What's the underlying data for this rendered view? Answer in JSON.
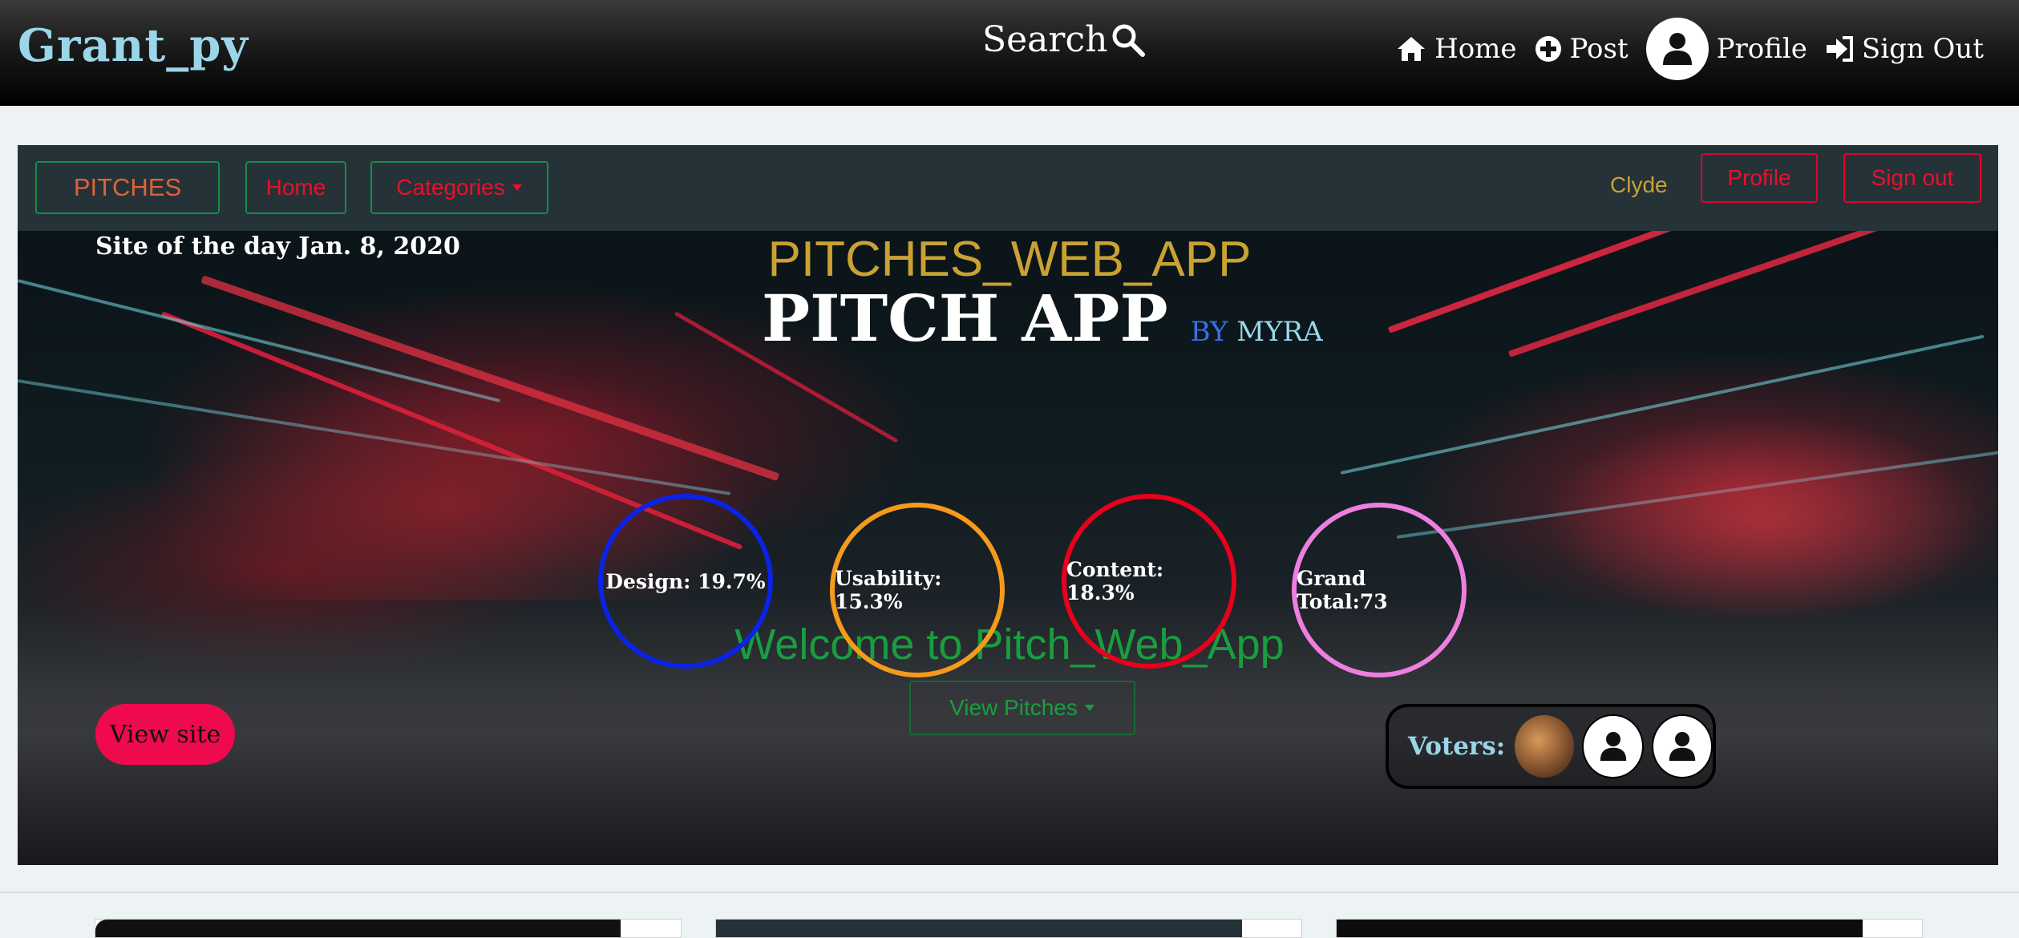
{
  "topbar": {
    "brand": "Grant_py",
    "search_label": "Search",
    "nav": {
      "home": "Home",
      "post": "Post",
      "profile": "Profile",
      "sign_out": "Sign Out"
    }
  },
  "inner_nav": {
    "brand": "PITCHES",
    "home": "Home",
    "categories": "Categories",
    "username": "Clyde",
    "profile": "Profile",
    "sign_out": "Sign out"
  },
  "hero": {
    "site_of_day": "Site of the day Jan. 8, 2020",
    "site_title": "PITCHES_WEB_APP",
    "app_name": "PITCH APP",
    "by": "BY",
    "author": "MYRA",
    "welcome": "Welcome to Pitch_Web_App",
    "view_pitches": "View Pitches",
    "view_site": "View site",
    "voters_label": "Voters:"
  },
  "scores": {
    "design": "Design: 19.7%",
    "usability": "Usability: 15.3%",
    "content": "Content: 18.3%",
    "grand_total": "Grand Total:73"
  },
  "colors": {
    "design_ring": "#0a23e6",
    "usability_ring": "#f59a1b",
    "content_ring": "#e8001c",
    "total_ring": "#ee7fe0",
    "accent_pink": "#ee0a4d",
    "brand_blue": "#9ad6e8",
    "gold": "#c9a233",
    "green": "#1a9d3f"
  },
  "icons": [
    "search-icon",
    "home-icon",
    "plus-circle-icon",
    "user-icon",
    "sign-out-icon",
    "caret-down-icon"
  ]
}
